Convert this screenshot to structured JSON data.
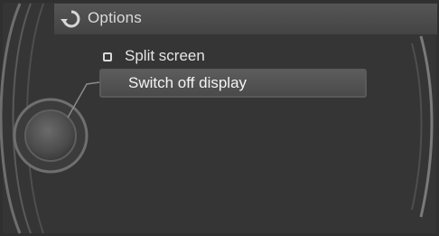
{
  "header": {
    "title": "Options",
    "back_icon": "back-arrow-icon"
  },
  "menu": {
    "items": [
      {
        "label": "Split screen",
        "icon": "split-screen-icon",
        "selected": false
      },
      {
        "label": "Switch off display",
        "selected": true
      }
    ]
  },
  "controller": {
    "icon": "idrive-controller-knob-icon"
  },
  "colors": {
    "background": "#333333",
    "header_bar": "#4a4a4a",
    "selection": "#525252",
    "text": "#e6e6e6"
  }
}
